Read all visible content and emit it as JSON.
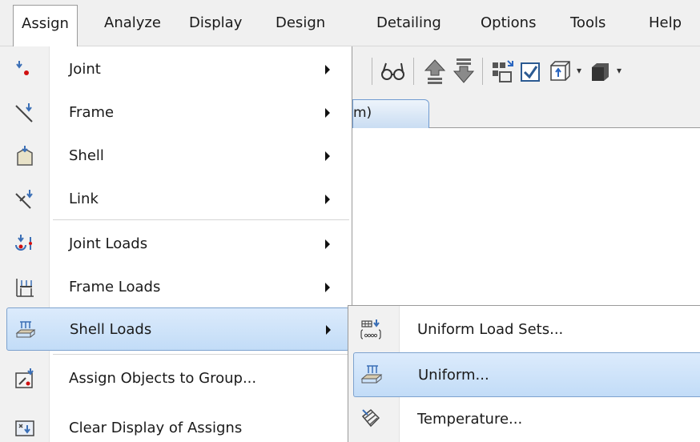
{
  "menubar": {
    "items": [
      "Assign",
      "Analyze",
      "Display",
      "Design",
      "Detailing",
      "Options",
      "Tools",
      "Help"
    ]
  },
  "tab": {
    "label": "m)"
  },
  "assign_menu": {
    "items": [
      {
        "label": "Joint",
        "icon": "joint-icon",
        "submenu": true
      },
      {
        "label": "Frame",
        "icon": "frame-icon",
        "submenu": true
      },
      {
        "label": "Shell",
        "icon": "shell-icon",
        "submenu": true
      },
      {
        "label": "Link",
        "icon": "link-icon",
        "submenu": true
      },
      {
        "label": "Joint Loads",
        "icon": "joint-loads-icon",
        "submenu": true
      },
      {
        "label": "Frame Loads",
        "icon": "frame-loads-icon",
        "submenu": true
      },
      {
        "label": "Shell Loads",
        "icon": "shell-loads-icon",
        "submenu": true,
        "highlighted": true
      },
      {
        "label": "Assign Objects to Group...",
        "icon": "group-assign-icon",
        "submenu": false
      },
      {
        "label": "Clear Display of Assigns",
        "icon": "clear-display-icon",
        "submenu": false
      }
    ]
  },
  "shell_loads_submenu": {
    "items": [
      {
        "label": "Uniform Load Sets...",
        "icon": "uniform-load-sets-icon"
      },
      {
        "label": "Uniform...",
        "icon": "uniform-load-icon",
        "highlighted": true
      },
      {
        "label": "Temperature...",
        "icon": "temperature-icon"
      }
    ]
  },
  "colors": {
    "highlight_fill": "#c8e0f8",
    "highlight_border": "#7da2ce",
    "tab_border": "#6f9bd1",
    "load_arrow_blue": "#3b6fb6",
    "joint_red": "#d01010"
  }
}
